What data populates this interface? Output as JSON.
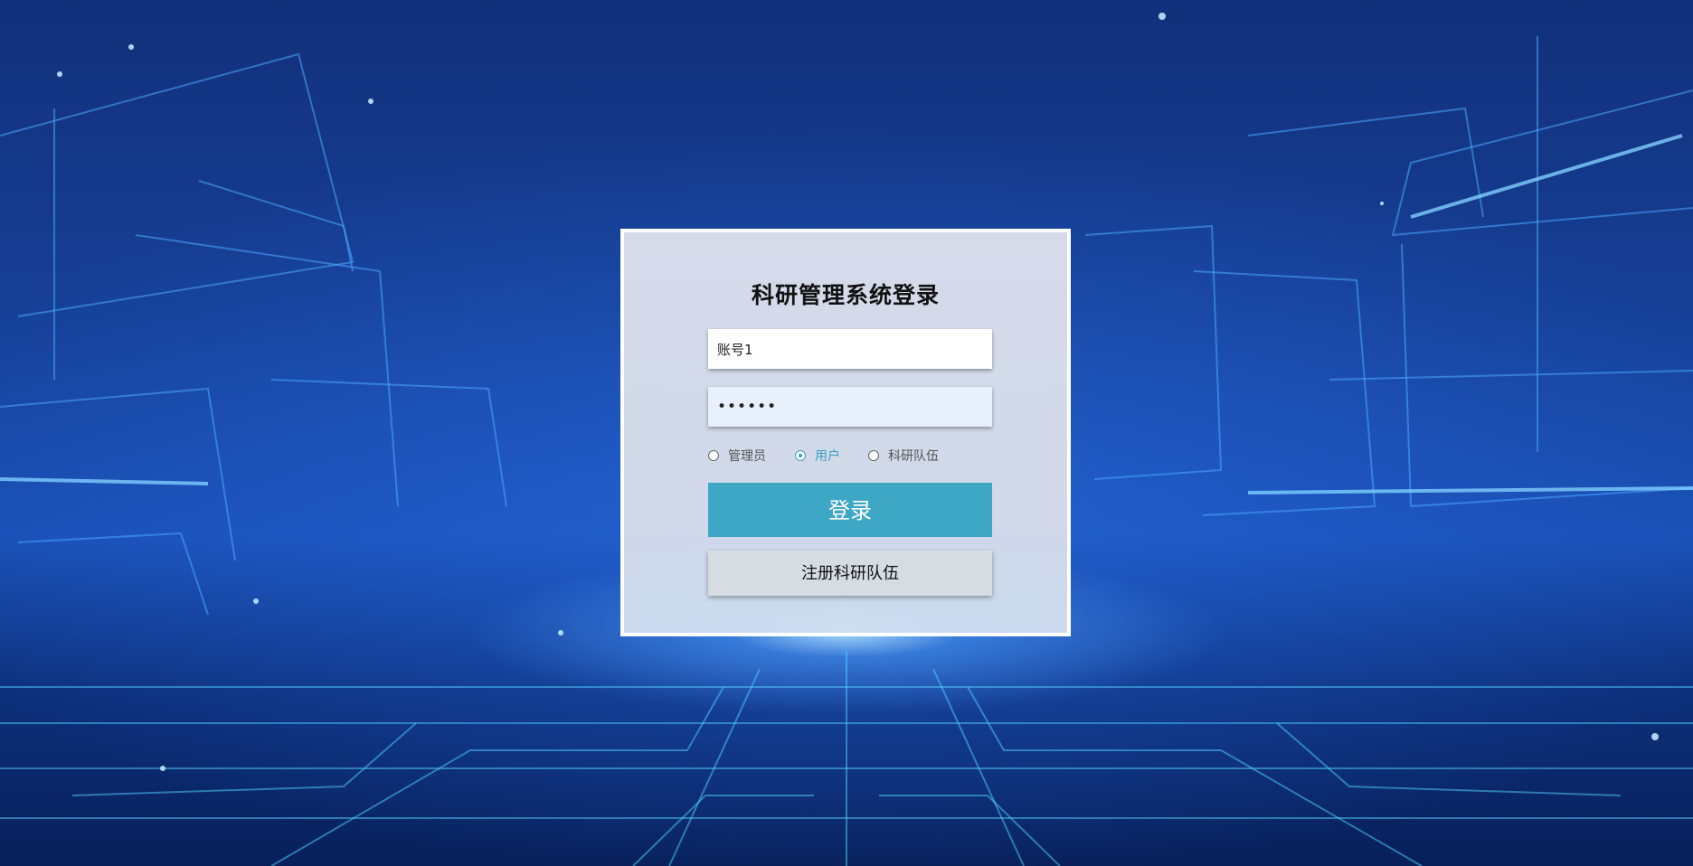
{
  "login": {
    "title": "科研管理系统登录",
    "account_value": "账号1",
    "password_mask": "••••••",
    "roles": [
      {
        "label": "管理员",
        "selected": false
      },
      {
        "label": "用户",
        "selected": true
      },
      {
        "label": "科研队伍",
        "selected": false
      }
    ],
    "login_button": "登录",
    "register_button": "注册科研队伍"
  },
  "colors": {
    "accent": "#3fa7c6",
    "register_bg": "#d5dde2",
    "background_dark": "#08205a",
    "background_mid": "#1a4fb4"
  }
}
